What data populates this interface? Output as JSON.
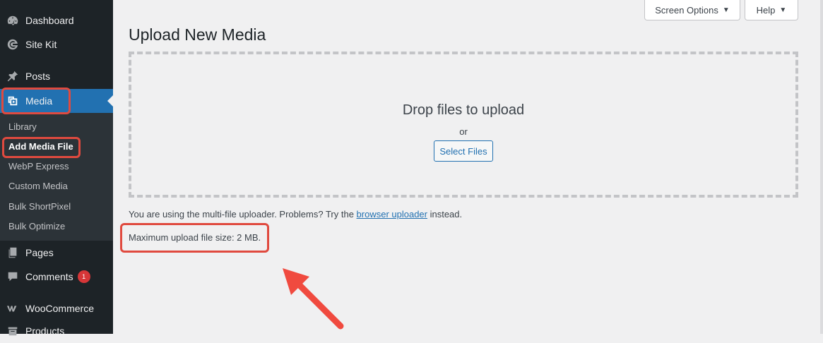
{
  "sidebar": {
    "items": [
      {
        "label": "Dashboard",
        "icon": "dashboard-icon"
      },
      {
        "label": "Site Kit",
        "icon": "site-kit-icon"
      },
      {
        "label": "Posts",
        "icon": "pin-icon"
      },
      {
        "label": "Media",
        "icon": "media-icon"
      },
      {
        "label": "Pages",
        "icon": "pages-icon"
      },
      {
        "label": "Comments",
        "icon": "comment-icon",
        "badge": "1"
      },
      {
        "label": "WooCommerce",
        "icon": "woocommerce-icon"
      },
      {
        "label": "Products",
        "icon": "products-icon"
      }
    ],
    "media_submenu": [
      "Library",
      "Add Media File",
      "WebP Express",
      "Custom Media",
      "Bulk ShortPixel",
      "Bulk Optimize"
    ]
  },
  "header": {
    "screen_options": "Screen Options",
    "help": "Help",
    "title": "Upload New Media"
  },
  "dropzone": {
    "title": "Drop files to upload",
    "or": "or",
    "select_files": "Select Files"
  },
  "notes": {
    "uploader_prefix": "You are using the multi-file uploader. Problems? Try the ",
    "uploader_link": "browser uploader",
    "uploader_suffix": " instead.",
    "max_size": "Maximum upload file size: 2 MB."
  },
  "colors": {
    "sidebar_bg": "#1d2327",
    "accent": "#2271b1",
    "highlight": "#e04a3f",
    "badge": "#d63638"
  }
}
